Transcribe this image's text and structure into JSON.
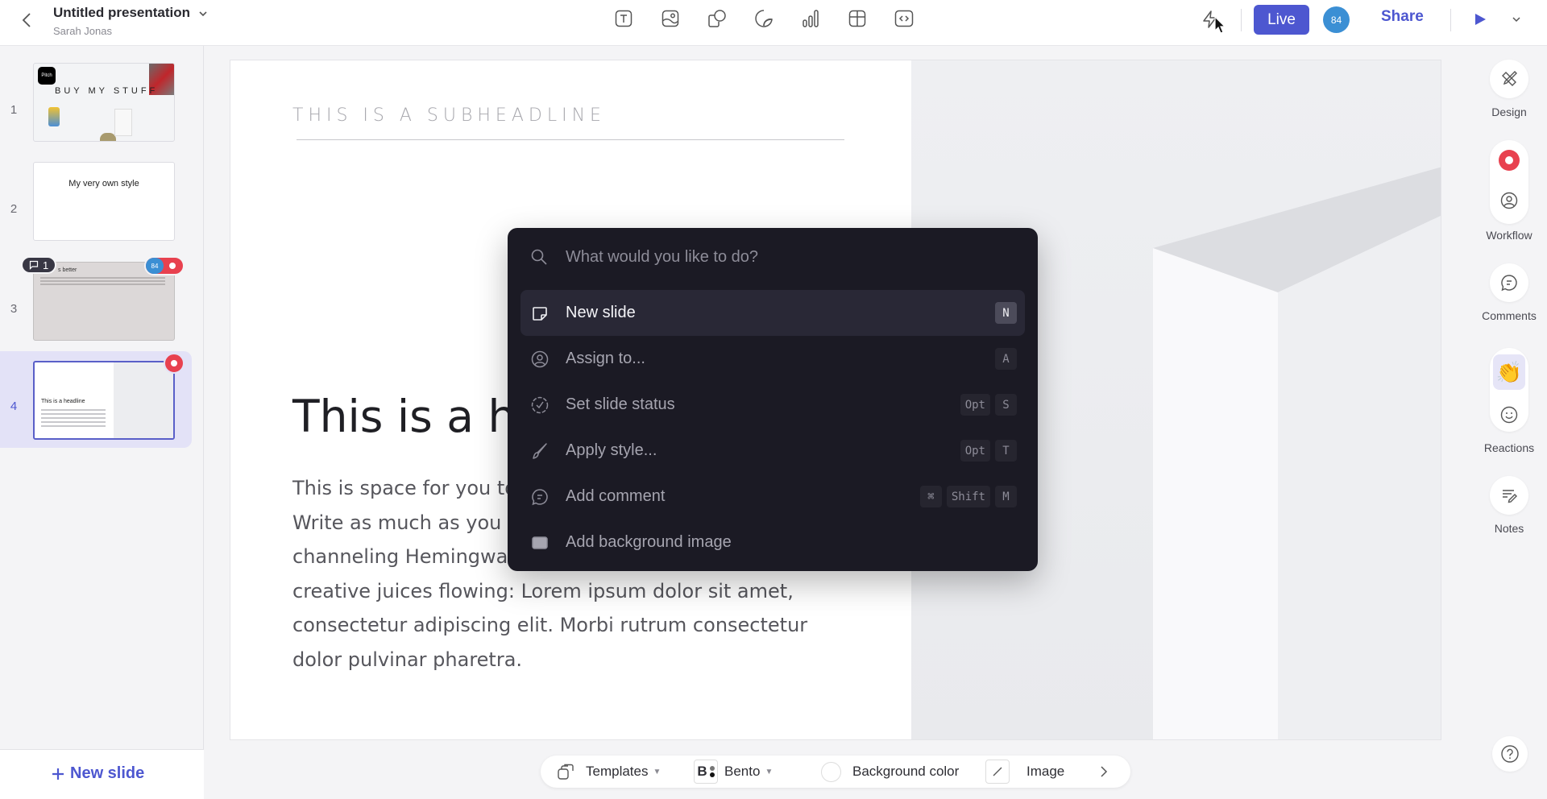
{
  "header": {
    "title": "Untitled presentation",
    "owner": "Sarah Jonas",
    "insert_tools": [
      {
        "name": "text",
        "icon": "text-box-icon"
      },
      {
        "name": "image",
        "icon": "image-icon"
      },
      {
        "name": "shape",
        "icon": "shapes-icon"
      },
      {
        "name": "sticker",
        "icon": "sticker-icon"
      },
      {
        "name": "chart",
        "icon": "chart-icon"
      },
      {
        "name": "table",
        "icon": "table-icon"
      },
      {
        "name": "embed",
        "icon": "embed-code-icon"
      }
    ],
    "live_label": "Live",
    "avatar_label": "84",
    "share_label": "Share"
  },
  "sidebar": {
    "slides": [
      {
        "number": "1",
        "thumb_title": "BUY MY STUFF",
        "thumb_logo": "Pitch"
      },
      {
        "number": "2",
        "thumb_title": "My very own style"
      },
      {
        "number": "3",
        "thumb_title": "s better",
        "comment_count": "1",
        "assignee": "84"
      },
      {
        "number": "4",
        "thumb_title": "This is a headline",
        "active": true
      }
    ],
    "new_slide_label": "New slide"
  },
  "slide": {
    "subheadline": "THIS IS A SUBHEADLINE",
    "headline": "This is a headline",
    "body": "This is space for you to explain your own typography. Write as much as you want or as little. If you're channeling Hemingway, write a little; to get your creative juices flowing: Lorem ipsum dolor sit amet, consectetur adipiscing elit. Morbi rutrum consectetur dolor pulvinar pharetra.",
    "body_lines": [
      "This is space for you to",
      "Write as much as you w",
      "channeling Hemingwa",
      "creative juices flowing: Lorem ipsum dolor sit amet,",
      "consectetur adipiscing elit. Morbi rutrum consectetur",
      "dolor pulvinar pharetra."
    ]
  },
  "palette": {
    "placeholder": "What would you like to do?",
    "commands": [
      {
        "label": "New slide",
        "icon": "new-slide-icon",
        "keys": [
          "N"
        ],
        "highlighted": true
      },
      {
        "label": "Assign to...",
        "icon": "user-circle-icon",
        "keys": [
          "A"
        ]
      },
      {
        "label": "Set slide status",
        "icon": "status-check-icon",
        "keys": [
          "Opt",
          "S"
        ]
      },
      {
        "label": "Apply style...",
        "icon": "brush-icon",
        "keys": [
          "Opt",
          "T"
        ]
      },
      {
        "label": "Add comment",
        "icon": "comment-icon",
        "keys": [
          "⌘",
          "Shift",
          "M"
        ]
      },
      {
        "label": "Add background image",
        "icon": "background-image-icon",
        "keys": []
      }
    ]
  },
  "right_rail": {
    "design_label": "Design",
    "workflow_label": "Workflow",
    "comments_label": "Comments",
    "reactions_label": "Reactions",
    "notes_label": "Notes",
    "reaction_emoji": "👏",
    "status_color": "#e8414f"
  },
  "bottom_bar": {
    "templates_label": "Templates",
    "theme_label": "Bento",
    "theme_badge": "B",
    "background_label": "Background color",
    "image_label": "Image"
  },
  "colors": {
    "accent": "#4d57d0",
    "status_red": "#e8414f",
    "avatar_blue": "#3b8fd4",
    "palette_bg": "#1b1a24"
  }
}
